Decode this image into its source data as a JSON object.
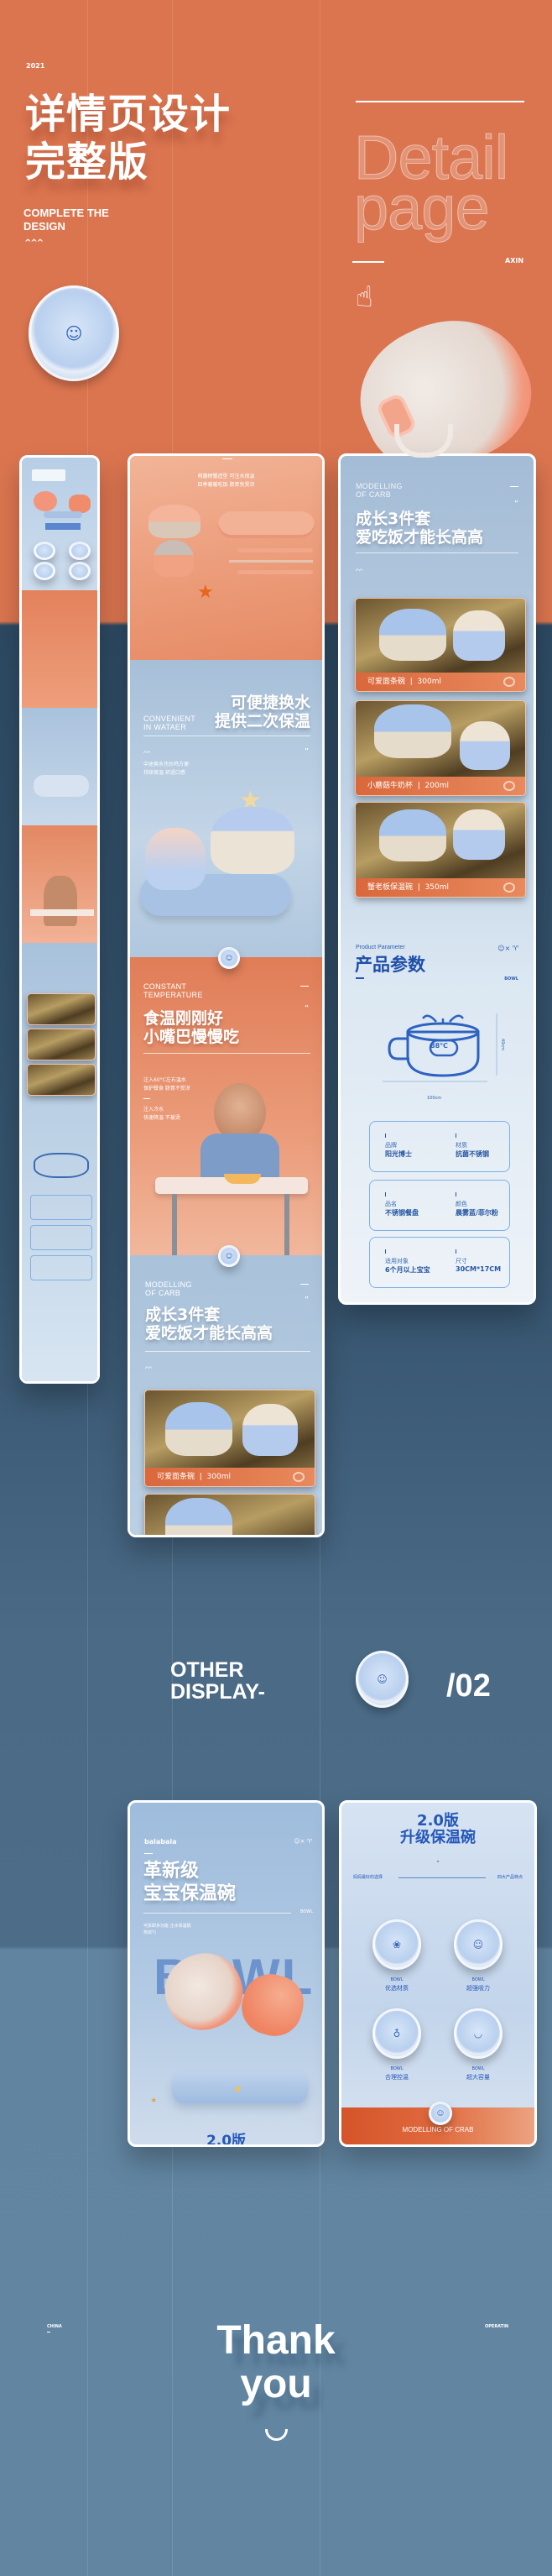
{
  "hero": {
    "year": "2021",
    "title_line1": "详情页设计",
    "title_line2": "完整版",
    "subtitle_line1": "COMPLETE THE",
    "subtitle_line2": "DESIGN",
    "zigzag": "^^^",
    "outline_line1": "Detail",
    "outline_line2": "page",
    "author": "AXIN",
    "hand_icon": "hand-pointer-icon",
    "bowl_icon": "baby-face-icon"
  },
  "col2": {
    "intro_line1": "萌趣螃蟹造型 可注水保温",
    "intro_line2": "四季暖暖吃饭 肠胃免受凉",
    "s2": {
      "en_line1": "CONVENIENT",
      "en_line2": "IN WATAER",
      "title_line1": "可便捷换水",
      "title_line2": "提供二次保温",
      "desc_line1": "中途换水也炒鸡方便",
      "desc_line2": "持续保温 舒适口感",
      "quote": "”"
    },
    "s3": {
      "en_line1": "CONSTANT",
      "en_line2": "TEMPERATURE",
      "title_line1": "食温刚刚好",
      "title_line2": "小嘴巴慢慢吃",
      "desc1_line1": "注入60°C左右温水",
      "desc1_line2": "保护餐食 肠胃不受凉",
      "desc2_line1": "注入冷水",
      "desc2_line2": "快速降温 不被烫",
      "quote": "”"
    },
    "s4": {
      "en_line1": "MODELLING",
      "en_line2": "OF CARB",
      "title_line1": "成长3件套",
      "title_line2": "爱吃饭才能长高高",
      "quote": "”"
    }
  },
  "products": [
    {
      "name": "可爱面条碗",
      "sep": "|",
      "volume": "300ml"
    },
    {
      "name": "小蘑菇牛奶杯",
      "sep": "|",
      "volume": "200ml"
    },
    {
      "name": "蟹老板保温碗",
      "sep": "|",
      "volume": "350ml"
    }
  ],
  "col3": {
    "en_line1": "MODELLING",
    "en_line2": "OF CARB",
    "title_line1": "成长3件套",
    "title_line2": "爱吃饭才能长高高",
    "quote": "”",
    "param_en": "Product Parameter",
    "param_title": "产品参数",
    "brand_mark": "☺× ♈",
    "bowl_label": "BOWL",
    "display": "88℃",
    "width_label": "100cm",
    "height_label": "40cm",
    "specs": [
      [
        {
          "k": "品牌",
          "v": "阳光博士"
        },
        {
          "k": "材质",
          "v": "抗菌不锈钢"
        }
      ],
      [
        {
          "k": "品名",
          "v": "不锈钢餐盘"
        },
        {
          "k": "颜色",
          "v": "晨雾蓝/菲尔粉"
        }
      ],
      [
        {
          "k": "适用对象",
          "v": "6个月以上宝宝"
        },
        {
          "k": "尺寸",
          "v": "30CM*17CM"
        }
      ]
    ]
  },
  "other": {
    "line1": "OTHER",
    "line2": "DISPLAY-",
    "number": "/02"
  },
  "cardA": {
    "brand": "balabala",
    "mark": "☺× ♈",
    "title_line1": "革新级",
    "title_line2": "宝宝保温碗",
    "tag": "BOWL",
    "desc_line1": "可拆卸多功能 注水保温隔",
    "desc_line2": "热双勺",
    "big": "BOWL",
    "version": "2.0版"
  },
  "cardB": {
    "title_line1": "2.0版",
    "title_line2": "升级保温碗",
    "quote": "”",
    "left": "妈妈最好的选择",
    "right": "四大产品特点",
    "features": [
      {
        "en": "BOWL",
        "cn": "优选材质",
        "icon": "circles-icon"
      },
      {
        "en": "BOWL",
        "cn": "超强吸力",
        "icon": "baby-face-icon"
      },
      {
        "en": "BOWL",
        "cn": "合理控温",
        "icon": "bottle-icon"
      },
      {
        "en": "BOWL",
        "cn": "超大容量",
        "icon": "bowl-icon"
      }
    ],
    "footer": "MODELLING OF CRAB"
  },
  "thanks": {
    "left": "CHINA",
    "right": "OPERATIN",
    "line1": "Thank",
    "line2": "you"
  },
  "colors": {
    "orange": "#DB7550",
    "navy": "#2D4A63",
    "steel": "#6286A2",
    "accent_blue": "#2457B8"
  }
}
